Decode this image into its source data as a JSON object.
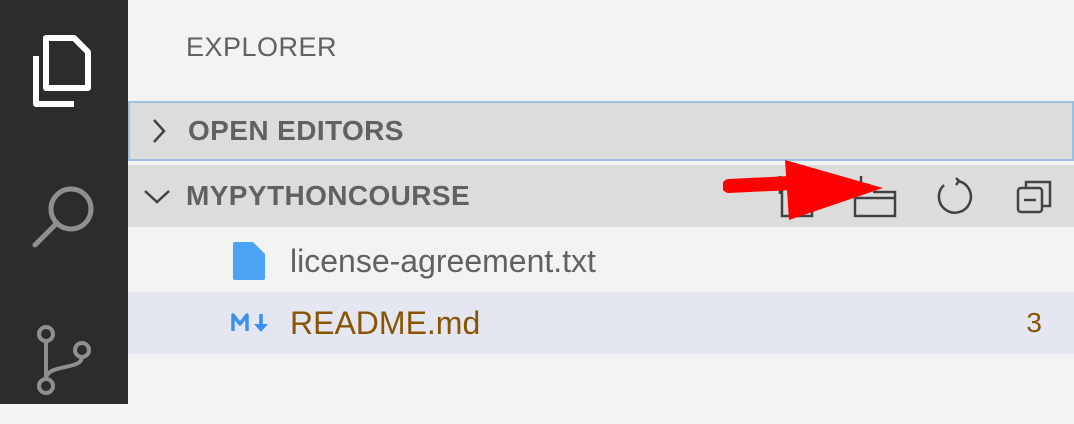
{
  "activity_bar": {
    "items": [
      {
        "icon": "files-icon"
      },
      {
        "icon": "search-icon"
      },
      {
        "icon": "source-control-icon"
      }
    ]
  },
  "sidebar": {
    "title": "EXPLORER",
    "sections": {
      "open_editors": {
        "label": "OPEN EDITORS",
        "expanded": false
      },
      "project": {
        "label": "MYPYTHONCOURSE",
        "expanded": true,
        "actions": [
          "new-file-icon",
          "new-folder-icon",
          "refresh-icon",
          "collapse-all-icon"
        ]
      }
    },
    "files": [
      {
        "name": "license-agreement.txt",
        "icon": "text-file-icon"
      },
      {
        "name": "README.md",
        "icon": "markdown-icon",
        "badge": "3"
      }
    ]
  },
  "colors": {
    "activity_bar": "#2c2c2c",
    "sidebar": "#f3f3f3",
    "section_header": "#dcdcdc",
    "selected_row": "#e4e6f1",
    "modified_text": "#895503",
    "annotation_arrow": "#ff0000"
  }
}
